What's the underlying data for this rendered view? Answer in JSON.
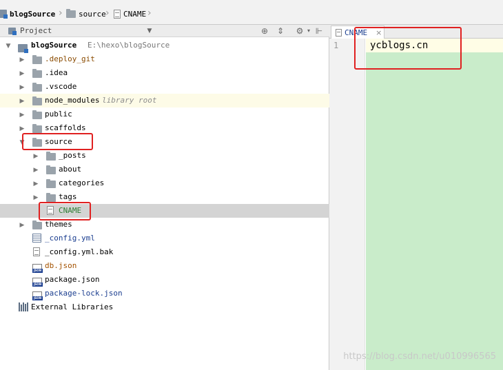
{
  "breadcrumb": {
    "items": [
      {
        "label": "blogSource",
        "icon": "project-folder-icon"
      },
      {
        "label": "source",
        "icon": "folder-icon"
      },
      {
        "label": "CNAME",
        "icon": "text-file-icon"
      }
    ]
  },
  "project_panel": {
    "title": "Project",
    "toolbar_icons": [
      "locate-icon",
      "collapse-all-icon",
      "gear-icon",
      "hide-icon"
    ],
    "root": {
      "label": "blogSource",
      "path": "E:\\hexo\\blogSource"
    },
    "items": [
      {
        "label": ".deploy_git",
        "type": "folder"
      },
      {
        "label": ".idea",
        "type": "folder"
      },
      {
        "label": ".vscode",
        "type": "folder"
      },
      {
        "label": "node_modules",
        "type": "folder",
        "hint": "library root"
      },
      {
        "label": "public",
        "type": "folder"
      },
      {
        "label": "scaffolds",
        "type": "folder"
      },
      {
        "label": "source",
        "type": "folder",
        "expanded": true
      },
      {
        "label": "_posts",
        "type": "folder"
      },
      {
        "label": "about",
        "type": "folder"
      },
      {
        "label": "categories",
        "type": "folder"
      },
      {
        "label": "tags",
        "type": "folder"
      },
      {
        "label": "CNAME",
        "type": "file",
        "selected": true
      },
      {
        "label": "themes",
        "type": "folder"
      },
      {
        "label": "_config.yml",
        "type": "yml"
      },
      {
        "label": "_config.yml.bak",
        "type": "file"
      },
      {
        "label": "db.json",
        "type": "json"
      },
      {
        "label": "package.json",
        "type": "json"
      },
      {
        "label": "package-lock.json",
        "type": "json"
      },
      {
        "label": "External Libraries",
        "type": "libraries"
      }
    ]
  },
  "editor": {
    "tab": {
      "label": "CNAME",
      "close": "×"
    },
    "lines": [
      {
        "number": "1",
        "text": "ycblogs.cn"
      }
    ]
  },
  "watermark": "https://blog.csdn.net/u010996565",
  "colors": {
    "highlight_box": "#e02020",
    "editor_added_bg": "#c9ecca",
    "selection": "#d4d4d4"
  }
}
